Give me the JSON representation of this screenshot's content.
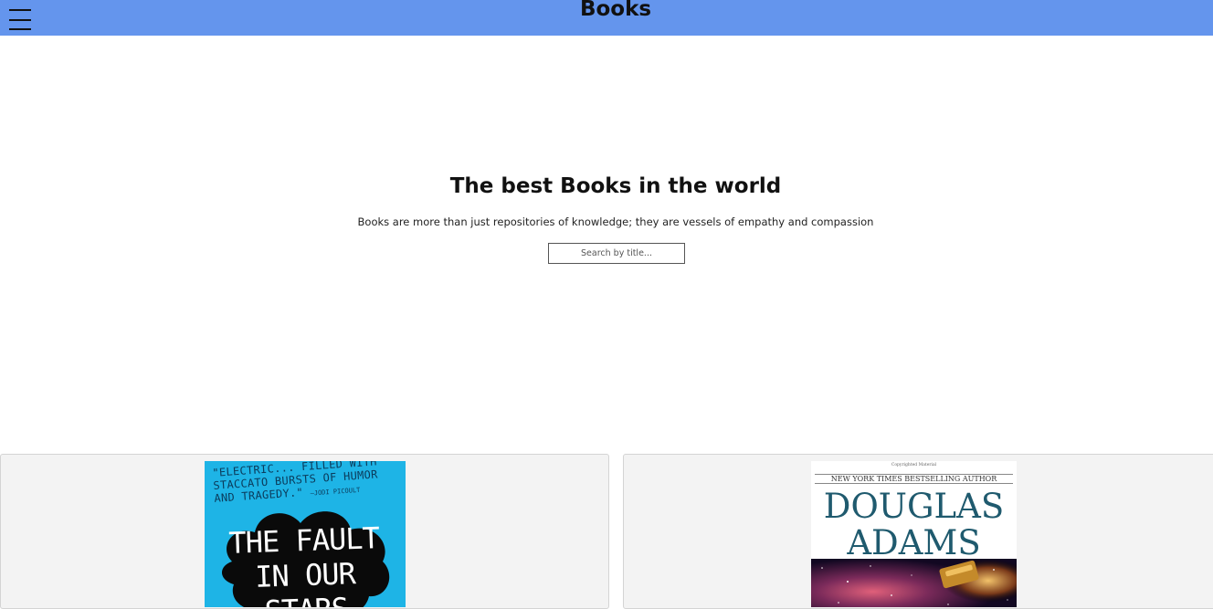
{
  "header": {
    "title": "Books",
    "menu_icon": "hamburger-menu-icon",
    "background_color": "#6495ed"
  },
  "hero": {
    "title": "The best Books in the world",
    "subtitle": "Books are more than just repositories of knowledge; they are vessels of empathy and compassion"
  },
  "search": {
    "placeholder": "Search by title..."
  },
  "books": [
    {
      "cover_blurb": "\"ELECTRIC... FILLED WITH STACCATO BURSTS OF HUMOR AND TRAGEDY.\"",
      "cover_blurb_attribution": "—JODI PICOULT",
      "cover_title": "THE FAULT IN OUR STARS",
      "cover_color": "#1eb4e6"
    },
    {
      "cover_copyright": "Copyrighted Material",
      "cover_tagline": "NEW YORK TIMES BESTSELLING AUTHOR",
      "cover_author": "DOUGLAS ADAMS",
      "cover_color": "#1f5a6e"
    }
  ]
}
